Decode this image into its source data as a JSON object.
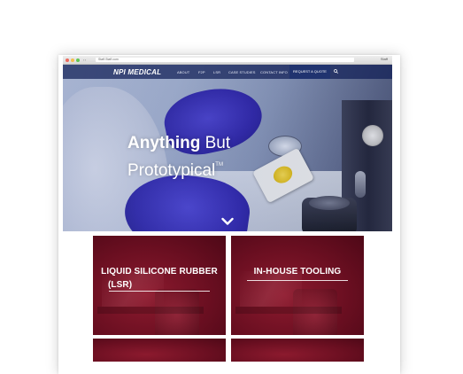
{
  "browser": {
    "url": "Staff.Staff.com",
    "user": "Staff",
    "tab_arrows": "‹ ›"
  },
  "nav": {
    "logo": "NPI MEDICAL",
    "items": [
      {
        "label": "ABOUT"
      },
      {
        "label": "F2P"
      },
      {
        "label": "LSR"
      },
      {
        "label": "CASE STUDIES"
      },
      {
        "label": "CONTACT INFO"
      }
    ],
    "cta": "REQUEST A QUOTE",
    "search_icon": "search-icon"
  },
  "hero": {
    "headline_bold": "Anything",
    "headline_rest": " But",
    "headline_line2": "Prototypical",
    "trademark": "TM",
    "scroll_icon": "chevron-down-icon"
  },
  "tiles": [
    {
      "line1": "LIQUID SILICONE RUBBER",
      "line2": "(LSR)"
    },
    {
      "line1": "IN-HOUSE TOOLING",
      "line2": ""
    }
  ],
  "colors": {
    "nav_bg": "#101e56",
    "cta_bg": "#20336f",
    "tile_red": "#6b0f21",
    "glove_blue": "#2e22a8"
  }
}
